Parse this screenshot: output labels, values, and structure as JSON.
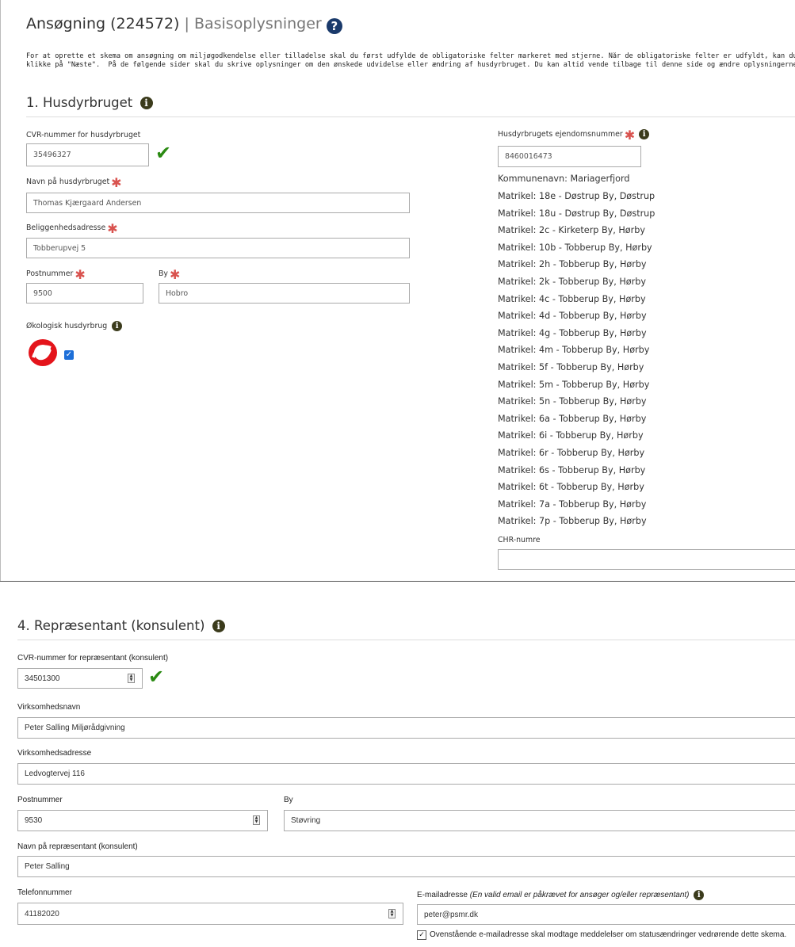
{
  "header": {
    "title": "Ansøgning (224572)",
    "separator": "|",
    "subtitle": "Basisoplysninger",
    "help_icon": "question-circle-icon",
    "intro_line1": "For at oprette et skema om ansøgning om miljøgodkendelse eller tilladelse skal du først udfylde de obligatoriske felter markeret med stjerne. Når de obligatoriske felter er udfyldt, kan du fortsætte ved",
    "intro_line2": "klikke på \"Næste\".  På de følgende sider skal du skrive oplysninger om den ønskede udvidelse eller ændring af husdyrbruget. Du kan altid vende tilbage til denne side og ændre oplysningerne."
  },
  "section1": {
    "title": "1. Husdyrbruget",
    "cvr_label": "CVR-nummer for husdyrbruget",
    "cvr_value": "35496327",
    "name_label": "Navn på husdyrbruget",
    "name_value": "Thomas Kjærgaard Andersen",
    "address_label": "Beliggenhedsadresse",
    "address_value": "Tobberupvej 5",
    "postal_label": "Postnummer",
    "postal_value": "9500",
    "city_label": "By",
    "city_value": "Hobro",
    "organic_label": "Økologisk husdyrbrug",
    "organic_checked": true,
    "property_label": "Husdyrbrugets ejendomsnummer",
    "property_value": "8460016473",
    "municipality": "Kommunenavn: Mariagerfjord",
    "matrikler": [
      "Matrikel: 18e - Døstrup By, Døstrup",
      "Matrikel: 18u - Døstrup By, Døstrup",
      "Matrikel: 2c - Kirketerp By, Hørby",
      "Matrikel: 10b - Tobberup By, Hørby",
      "Matrikel: 2h - Tobberup By, Hørby",
      "Matrikel: 2k - Tobberup By, Hørby",
      "Matrikel: 4c - Tobberup By, Hørby",
      "Matrikel: 4d - Tobberup By, Hørby",
      "Matrikel: 4g - Tobberup By, Hørby",
      "Matrikel: 4m - Tobberup By, Hørby",
      "Matrikel: 5f - Tobberup By, Hørby",
      "Matrikel: 5m - Tobberup By, Hørby",
      "Matrikel: 5n - Tobberup By, Hørby",
      "Matrikel: 6a - Tobberup By, Hørby",
      "Matrikel: 6i - Tobberup By, Hørby",
      "Matrikel: 6r - Tobberup By, Hørby",
      "Matrikel: 6s - Tobberup By, Hørby",
      "Matrikel: 6t - Tobberup By, Hørby",
      "Matrikel: 7a - Tobberup By, Hørby",
      "Matrikel: 7p - Tobberup By, Hørby"
    ],
    "chr_label": "CHR-numre",
    "chr_value": ""
  },
  "section4": {
    "title": "4. Repræsentant (konsulent)",
    "cvr_label": "CVR-nummer for repræsentant (konsulent)",
    "cvr_value": "34501300",
    "company_label": "Virksomhedsnavn",
    "company_value": "Peter Salling Miljørådgivning",
    "company_address_label": "Virksomhedsadresse",
    "company_address_value": "Ledvogtervej 116",
    "postal_label": "Postnummer",
    "postal_value": "9530",
    "city_label": "By",
    "city_value": "Støvring",
    "rep_name_label": "Navn på repræsentant (konsulent)",
    "rep_name_value": "Peter Salling",
    "phone_label": "Telefonnummer",
    "phone_value": "41182020",
    "email_label": "E-mailadresse",
    "email_note": "(En valid email er påkrævet for ansøger og/eller repræsentant)",
    "email_value": "peter@psmr.dk",
    "notify_label": "Ovenstående e-mailadresse skal modtage meddelelser om statusændringer vedrørende dette skema.",
    "notify_checked": true
  },
  "colors": {
    "required": "#d9534f",
    "checkmark": "#2a8a12",
    "info_icon": "#3b3b1c",
    "help_icon": "#1a3a6b",
    "checkbox": "#1d6fd8"
  },
  "icons": {
    "required": "asterisk-icon",
    "info": "info-circle-icon",
    "valid": "check-icon",
    "organic": "organic-logo-icon"
  }
}
